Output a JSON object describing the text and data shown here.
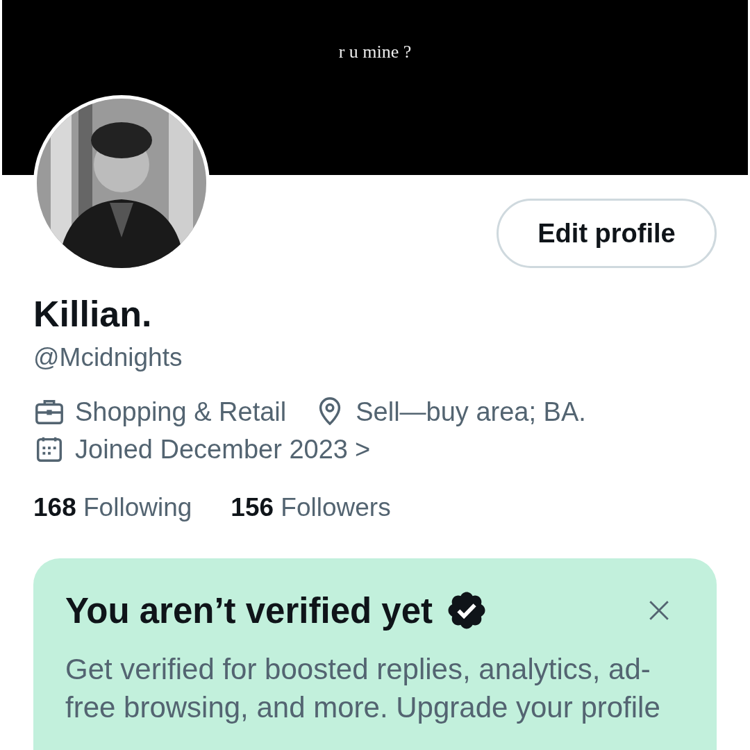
{
  "banner": {
    "caption": "r u mine ?"
  },
  "edit_button": "Edit profile",
  "profile": {
    "name": "Killian.",
    "handle": "@Mcidnights"
  },
  "meta": [
    {
      "kind": "category",
      "text": "Shopping & Retail"
    },
    {
      "kind": "location",
      "text": "Sell—buy area; BA."
    },
    {
      "kind": "joined",
      "text": "Joined December 2023",
      "chevron": ">"
    }
  ],
  "stats": [
    {
      "count": "168",
      "label": "Following"
    },
    {
      "count": "156",
      "label": "Followers"
    }
  ],
  "verify_card": {
    "title": "You aren’t verified yet",
    "body": "Get verified for boosted replies, analytics, ad-free browsing, and more. Upgrade your profile"
  }
}
